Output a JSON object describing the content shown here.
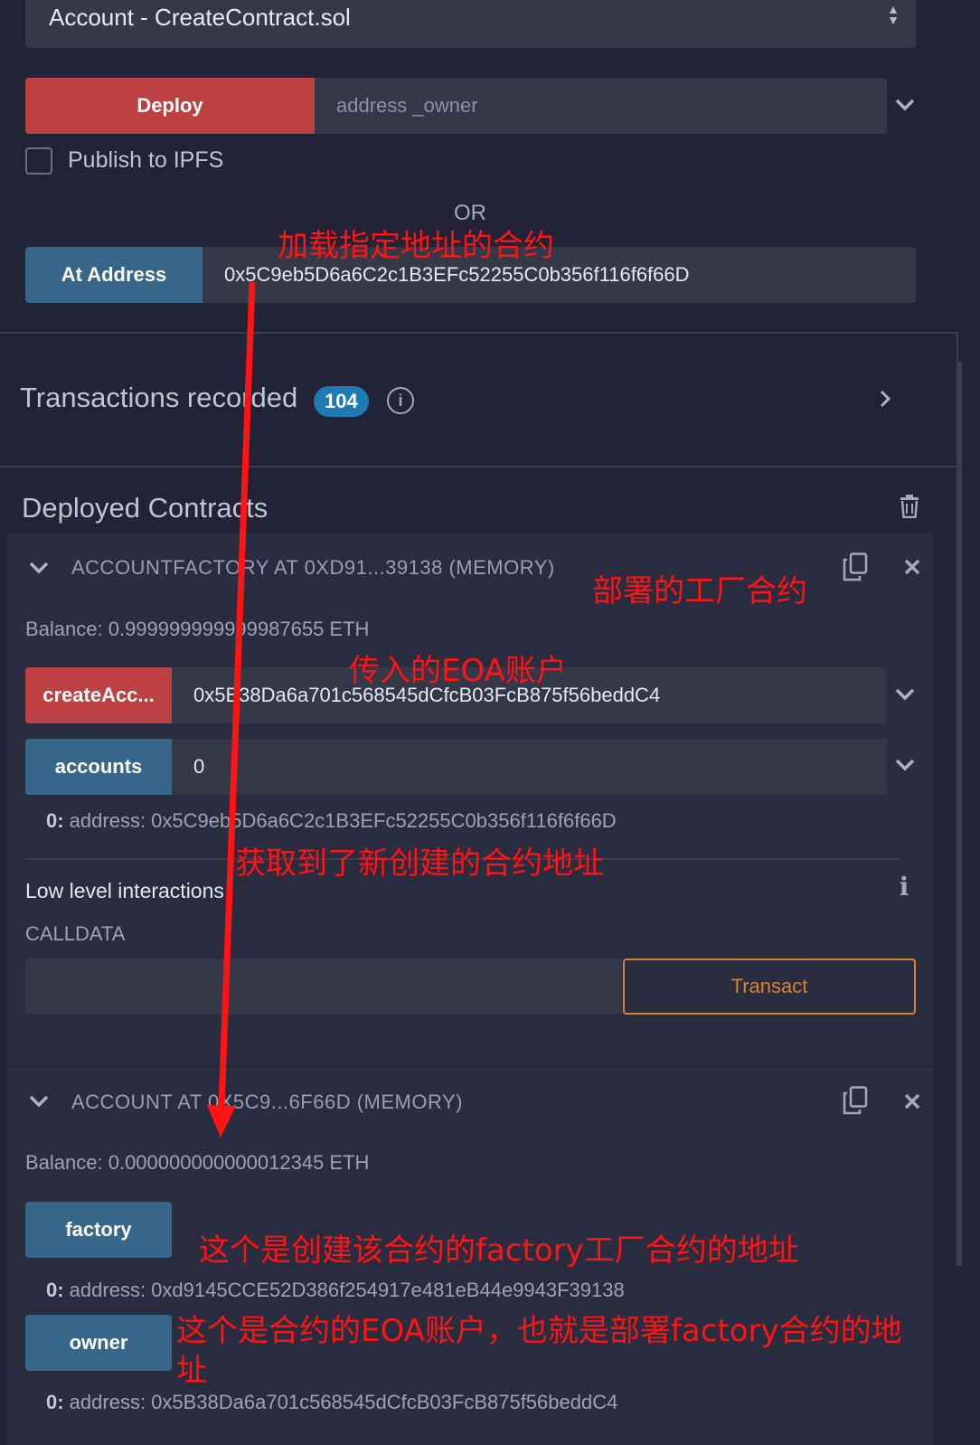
{
  "contract_select": {
    "value": "Account - CreateContract.sol"
  },
  "deploy": {
    "button": "Deploy",
    "placeholder": "address _owner",
    "publish_label": "Publish to IPFS"
  },
  "or_label": "OR",
  "at_address": {
    "button": "At Address",
    "value": "0x5C9eb5D6a6C2c1B3EFc52255C0b356f116f6f66D"
  },
  "transactions": {
    "label": "Transactions recorded",
    "count": "104"
  },
  "deployed": {
    "title": "Deployed Contracts"
  },
  "factory_contract": {
    "header": "ACCOUNTFACTORY AT 0XD91...39138 (MEMORY)",
    "balance": "Balance: 0.999999999999987655 ETH",
    "create_button": "createAcc...",
    "create_value": "0x5B38Da6a701c568545dCfcB03FcB875f56beddC4",
    "accounts_button": "accounts",
    "accounts_value": "0",
    "result_prefix": "0:",
    "result_value": " address: 0x5C9eb5D6a6C2c1B3EFc52255C0b356f116f6f66D"
  },
  "low_level": {
    "title": "Low level interactions",
    "calldata_label": "CALLDATA",
    "transact": "Transact"
  },
  "account_contract": {
    "header": "ACCOUNT AT 0X5C9...6F66D (MEMORY)",
    "balance": "Balance: 0.000000000000012345 ETH",
    "factory_button": "factory",
    "factory_prefix": "0:",
    "factory_result": " address: 0xd9145CCE52D386f254917e481eB44e9943F39138",
    "owner_button": "owner",
    "owner_prefix": "0:",
    "owner_result": " address: 0x5B38Da6a701c568545dCfcB03FcB875f56beddC4"
  },
  "annotations": {
    "load_at_address": "加载指定地址的合约",
    "deployed_factory": "部署的工厂合约",
    "eoa_input": "传入的EOA账户",
    "got_new_address": "获取到了新创建的合约地址",
    "factory_note": "这个是创建该合约的factory工厂合约的地址",
    "owner_note": "这个是合约的EOA账户，也就是部署factory合约的地址"
  },
  "colors": {
    "deploy_red": "#bd4143",
    "action_blue": "#366689",
    "badge_blue": "#1d7ab4",
    "transact_orange": "#d9822b",
    "annotation_red": "#ff1414"
  }
}
